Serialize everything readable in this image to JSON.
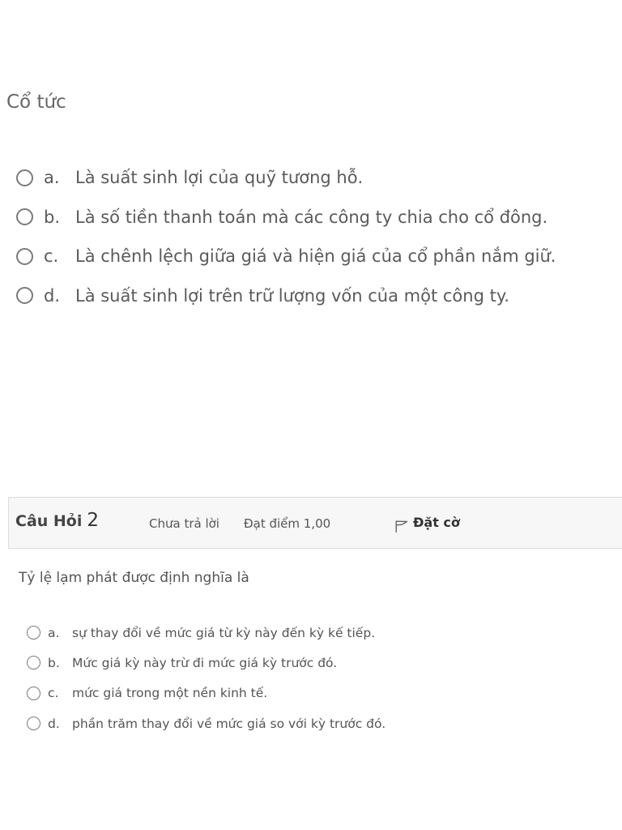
{
  "question1": {
    "text": "Cổ tức",
    "options": [
      {
        "letter": "a.",
        "text": "Là suất sinh lợi của quỹ tương hỗ."
      },
      {
        "letter": "b.",
        "text": "Là số tiền thanh toán mà các công ty chia cho cổ đông."
      },
      {
        "letter": "c.",
        "text": "Là chênh lệch giữa giá và hiện giá của cổ phần nắm giữ."
      },
      {
        "letter": "d.",
        "text": "Là suất sinh lợi trên trữ lượng vốn của một công ty."
      }
    ]
  },
  "question2": {
    "title_label": "Câu Hỏi",
    "number": "2",
    "state": "Chưa trả lời",
    "grade": "Đạt điểm 1,00",
    "flag_label": "Đặt cờ",
    "flag_icon": "flag-icon",
    "text": "Tỷ lệ lạm phát được định nghĩa là",
    "options": [
      {
        "letter": "a.",
        "text": "sự thay đổi về mức giá từ kỳ này đến kỳ kế tiếp."
      },
      {
        "letter": "b.",
        "text": "Mức giá kỳ này trừ đi mức giá kỳ trước đó."
      },
      {
        "letter": "c.",
        "text": "mức giá trong một nền kinh tế."
      },
      {
        "letter": "d.",
        "text": "phần trăm thay đổi về mức giá so với kỳ trước đó."
      }
    ]
  }
}
